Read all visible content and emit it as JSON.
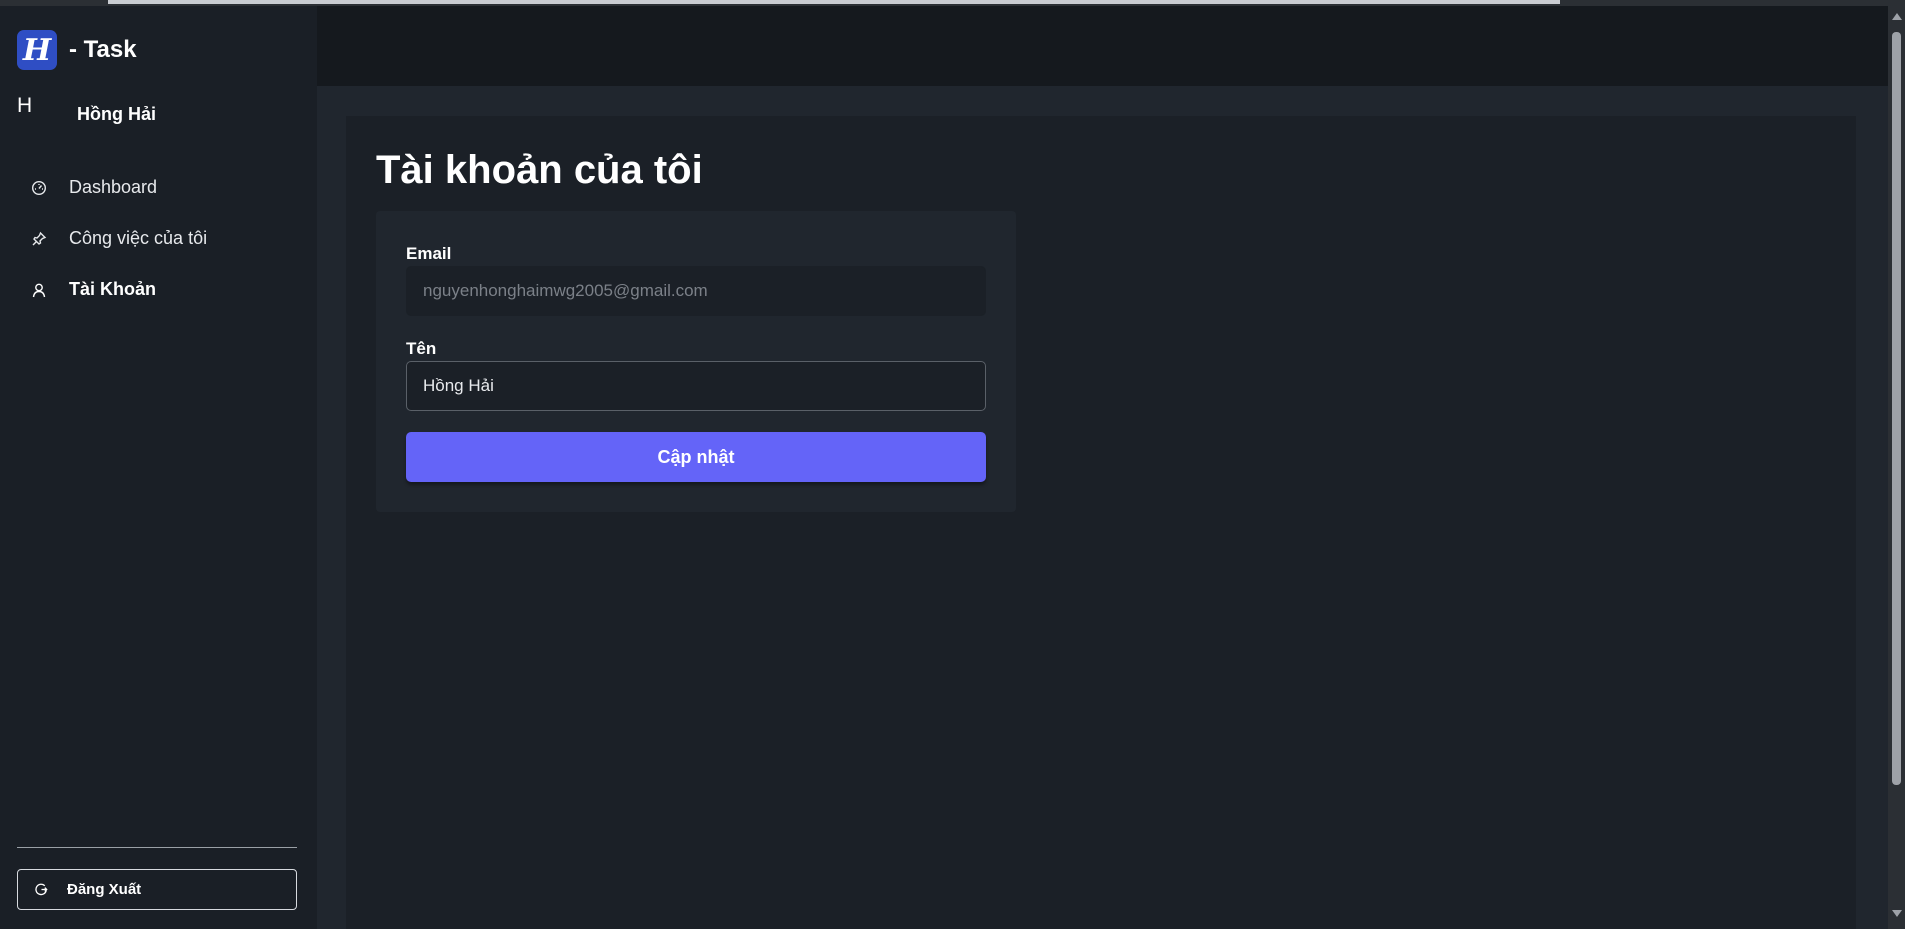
{
  "app": {
    "logo_letter": "H",
    "title": "- Task"
  },
  "user": {
    "avatar_initial": "H",
    "name": "Hồng Hải"
  },
  "sidebar": {
    "items": [
      {
        "label": "Dashboard",
        "icon": "dashboard-gauge-icon",
        "active": false
      },
      {
        "label": "Công việc của tôi",
        "icon": "pin-icon",
        "active": false
      },
      {
        "label": "Tài Khoản",
        "icon": "user-icon",
        "active": true
      }
    ],
    "logout_label": "Đăng Xuất",
    "logout_icon": "logout-icon"
  },
  "page": {
    "title": "Tài khoản của tôi"
  },
  "form": {
    "email_label": "Email",
    "email_value": "nguyenhonghaimwg2005@gmail.com",
    "name_label": "Tên",
    "name_value": "Hồng Hải",
    "submit_label": "Cập nhật"
  },
  "colors": {
    "accent": "#6464f8",
    "logo_bg": "#2f4ec4",
    "sidebar_bg": "#1a1f26",
    "content_bg": "#1b2027"
  }
}
